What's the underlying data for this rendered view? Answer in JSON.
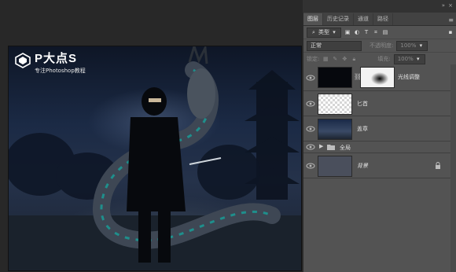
{
  "logo": {
    "title": "P大点S",
    "subtitle": "专注Photoshop教程"
  },
  "panel": {
    "tabs": [
      "图层",
      "历史记录",
      "通道",
      "路径"
    ],
    "filter_select": "类型",
    "blend_mode": "正常",
    "opacity_label": "不透明度:",
    "opacity_value": "100%",
    "lock_label": "锁定:",
    "fill_label": "填充:",
    "fill_value": "100%",
    "menu_icon": "menu-icon"
  },
  "layers": [
    {
      "name": "光线调整",
      "type": "adjustment"
    },
    {
      "name": "匕首",
      "type": "pixel"
    },
    {
      "name": "盖章",
      "type": "pixel"
    },
    {
      "name": "全局",
      "type": "group"
    },
    {
      "name": "背景",
      "type": "background"
    }
  ],
  "colors": {
    "panel_bg": "#535353",
    "canvas_bg": "#282828",
    "text": "#e0e0e0"
  }
}
